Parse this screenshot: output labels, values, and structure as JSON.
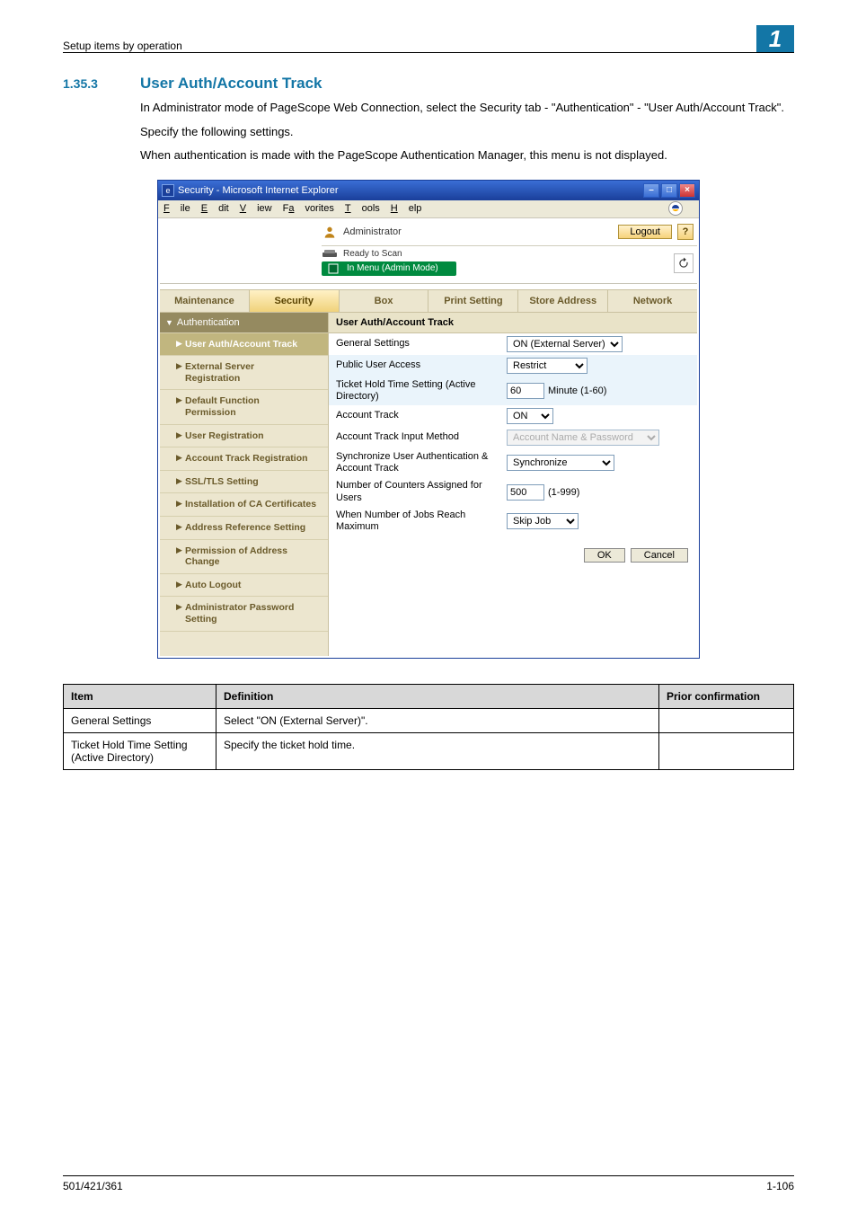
{
  "header": {
    "breadcrumb": "Setup items by operation",
    "chapter_badge": "1"
  },
  "section": {
    "number": "1.35.3",
    "title": "User Auth/Account Track"
  },
  "paragraphs": {
    "p1": "In Administrator mode of PageScope Web Connection, select the Security tab - \"Authentication\" - \"User Auth/Account Track\".",
    "p2": "Specify the following settings.",
    "p3": "When authentication is made with the PageScope Authentication Manager, this menu is not displayed."
  },
  "shot": {
    "title": "Security - Microsoft Internet Explorer",
    "menu": {
      "file": "File",
      "edit": "Edit",
      "view": "View",
      "favorites": "Favorites",
      "tools": "Tools",
      "help": "Help"
    },
    "admin_label": "Administrator",
    "logout_label": "Logout",
    "status_ready": "Ready to Scan",
    "status_mode": "In Menu (Admin Mode)",
    "tabs": {
      "maintenance": "Maintenance",
      "security": "Security",
      "box": "Box",
      "print": "Print Setting",
      "store": "Store Address",
      "network": "Network"
    },
    "sidebar": {
      "group": "Authentication",
      "items": [
        {
          "label": "User Auth/Account Track"
        },
        {
          "label": "External Server\nRegistration"
        },
        {
          "label": "Default Function\nPermission"
        },
        {
          "label": "User Registration"
        },
        {
          "label": "Account Track Registration"
        },
        {
          "label": "SSL/TLS Setting"
        },
        {
          "label": "Installation of CA Certificates"
        },
        {
          "label": "Address Reference Setting"
        },
        {
          "label": "Permission of Address\nChange"
        },
        {
          "label": "Auto Logout"
        },
        {
          "label": "Administrator Password\nSetting"
        }
      ]
    },
    "main": {
      "heading": "User Auth/Account Track",
      "rows": {
        "general": {
          "label": "General Settings",
          "value": "ON (External Server)"
        },
        "public": {
          "label": "Public User Access",
          "value": "Restrict"
        },
        "ticket": {
          "label": "Ticket Hold Time Setting (Active Directory)",
          "value": "60",
          "suffix": "Minute (1-60)"
        },
        "acct": {
          "label": "Account Track",
          "value": "ON"
        },
        "input_method": {
          "label": "Account Track Input Method",
          "value": "Account Name & Password"
        },
        "sync": {
          "label": "Synchronize User Authentication & Account Track",
          "value": "Synchronize"
        },
        "counters": {
          "label": "Number of Counters Assigned for Users",
          "value": "500",
          "suffix": "(1-999)"
        },
        "max": {
          "label": "When Number of Jobs Reach Maximum",
          "value": "Skip Job"
        }
      },
      "ok": "OK",
      "cancel": "Cancel"
    }
  },
  "table": {
    "headers": {
      "item": "Item",
      "definition": "Definition",
      "prior": "Prior confirmation"
    },
    "rows": [
      {
        "item": "General Settings",
        "definition": "Select \"ON (External Server)\".",
        "prior": ""
      },
      {
        "item": "Ticket Hold Time Setting (Active Directory)",
        "definition": "Specify the ticket hold time.",
        "prior": ""
      }
    ]
  },
  "footer": {
    "left": "501/421/361",
    "right": "1-106"
  }
}
